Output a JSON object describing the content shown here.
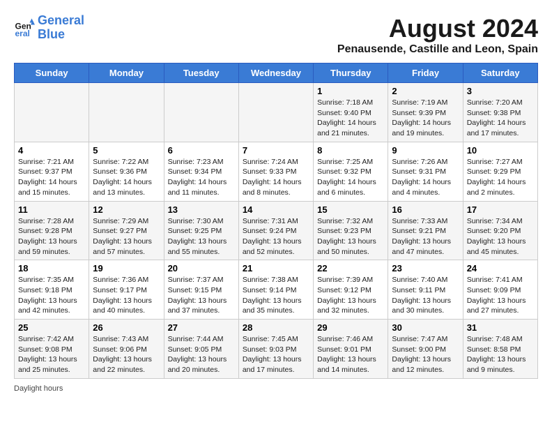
{
  "logo": {
    "line1": "General",
    "line2": "Blue"
  },
  "title": "August 2024",
  "subtitle": "Penausende, Castille and Leon, Spain",
  "days_of_week": [
    "Sunday",
    "Monday",
    "Tuesday",
    "Wednesday",
    "Thursday",
    "Friday",
    "Saturday"
  ],
  "weeks": [
    [
      {
        "day": "",
        "info": ""
      },
      {
        "day": "",
        "info": ""
      },
      {
        "day": "",
        "info": ""
      },
      {
        "day": "",
        "info": ""
      },
      {
        "day": "1",
        "info": "Sunrise: 7:18 AM\nSunset: 9:40 PM\nDaylight: 14 hours and 21 minutes."
      },
      {
        "day": "2",
        "info": "Sunrise: 7:19 AM\nSunset: 9:39 PM\nDaylight: 14 hours and 19 minutes."
      },
      {
        "day": "3",
        "info": "Sunrise: 7:20 AM\nSunset: 9:38 PM\nDaylight: 14 hours and 17 minutes."
      }
    ],
    [
      {
        "day": "4",
        "info": "Sunrise: 7:21 AM\nSunset: 9:37 PM\nDaylight: 14 hours and 15 minutes."
      },
      {
        "day": "5",
        "info": "Sunrise: 7:22 AM\nSunset: 9:36 PM\nDaylight: 14 hours and 13 minutes."
      },
      {
        "day": "6",
        "info": "Sunrise: 7:23 AM\nSunset: 9:34 PM\nDaylight: 14 hours and 11 minutes."
      },
      {
        "day": "7",
        "info": "Sunrise: 7:24 AM\nSunset: 9:33 PM\nDaylight: 14 hours and 8 minutes."
      },
      {
        "day": "8",
        "info": "Sunrise: 7:25 AM\nSunset: 9:32 PM\nDaylight: 14 hours and 6 minutes."
      },
      {
        "day": "9",
        "info": "Sunrise: 7:26 AM\nSunset: 9:31 PM\nDaylight: 14 hours and 4 minutes."
      },
      {
        "day": "10",
        "info": "Sunrise: 7:27 AM\nSunset: 9:29 PM\nDaylight: 14 hours and 2 minutes."
      }
    ],
    [
      {
        "day": "11",
        "info": "Sunrise: 7:28 AM\nSunset: 9:28 PM\nDaylight: 13 hours and 59 minutes."
      },
      {
        "day": "12",
        "info": "Sunrise: 7:29 AM\nSunset: 9:27 PM\nDaylight: 13 hours and 57 minutes."
      },
      {
        "day": "13",
        "info": "Sunrise: 7:30 AM\nSunset: 9:25 PM\nDaylight: 13 hours and 55 minutes."
      },
      {
        "day": "14",
        "info": "Sunrise: 7:31 AM\nSunset: 9:24 PM\nDaylight: 13 hours and 52 minutes."
      },
      {
        "day": "15",
        "info": "Sunrise: 7:32 AM\nSunset: 9:23 PM\nDaylight: 13 hours and 50 minutes."
      },
      {
        "day": "16",
        "info": "Sunrise: 7:33 AM\nSunset: 9:21 PM\nDaylight: 13 hours and 47 minutes."
      },
      {
        "day": "17",
        "info": "Sunrise: 7:34 AM\nSunset: 9:20 PM\nDaylight: 13 hours and 45 minutes."
      }
    ],
    [
      {
        "day": "18",
        "info": "Sunrise: 7:35 AM\nSunset: 9:18 PM\nDaylight: 13 hours and 42 minutes."
      },
      {
        "day": "19",
        "info": "Sunrise: 7:36 AM\nSunset: 9:17 PM\nDaylight: 13 hours and 40 minutes."
      },
      {
        "day": "20",
        "info": "Sunrise: 7:37 AM\nSunset: 9:15 PM\nDaylight: 13 hours and 37 minutes."
      },
      {
        "day": "21",
        "info": "Sunrise: 7:38 AM\nSunset: 9:14 PM\nDaylight: 13 hours and 35 minutes."
      },
      {
        "day": "22",
        "info": "Sunrise: 7:39 AM\nSunset: 9:12 PM\nDaylight: 13 hours and 32 minutes."
      },
      {
        "day": "23",
        "info": "Sunrise: 7:40 AM\nSunset: 9:11 PM\nDaylight: 13 hours and 30 minutes."
      },
      {
        "day": "24",
        "info": "Sunrise: 7:41 AM\nSunset: 9:09 PM\nDaylight: 13 hours and 27 minutes."
      }
    ],
    [
      {
        "day": "25",
        "info": "Sunrise: 7:42 AM\nSunset: 9:08 PM\nDaylight: 13 hours and 25 minutes."
      },
      {
        "day": "26",
        "info": "Sunrise: 7:43 AM\nSunset: 9:06 PM\nDaylight: 13 hours and 22 minutes."
      },
      {
        "day": "27",
        "info": "Sunrise: 7:44 AM\nSunset: 9:05 PM\nDaylight: 13 hours and 20 minutes."
      },
      {
        "day": "28",
        "info": "Sunrise: 7:45 AM\nSunset: 9:03 PM\nDaylight: 13 hours and 17 minutes."
      },
      {
        "day": "29",
        "info": "Sunrise: 7:46 AM\nSunset: 9:01 PM\nDaylight: 13 hours and 14 minutes."
      },
      {
        "day": "30",
        "info": "Sunrise: 7:47 AM\nSunset: 9:00 PM\nDaylight: 13 hours and 12 minutes."
      },
      {
        "day": "31",
        "info": "Sunrise: 7:48 AM\nSunset: 8:58 PM\nDaylight: 13 hours and 9 minutes."
      }
    ]
  ],
  "footer": "Daylight hours"
}
